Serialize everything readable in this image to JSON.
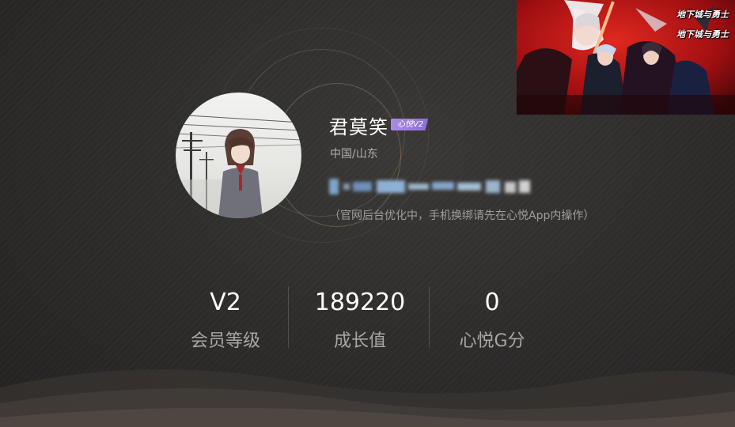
{
  "profile": {
    "username": "君莫笑",
    "vip_badge": "心悦V2",
    "location": "中国/山东",
    "notice": "（官网后台优化中，手机换绑请先在心悦App内操作）"
  },
  "stats": [
    {
      "value": "V2",
      "label": "会员等级"
    },
    {
      "value": "189220",
      "label": "成长值"
    },
    {
      "value": "0",
      "label": "心悦G分"
    }
  ],
  "game_banner": {
    "logo_text": "地下城与勇士"
  },
  "colors": {
    "background": "#2b2a29",
    "vip_purple": "#9b7de0",
    "text_primary": "#ffffff",
    "text_secondary": "#a9a7a4",
    "banner_red": "#b8141a"
  }
}
